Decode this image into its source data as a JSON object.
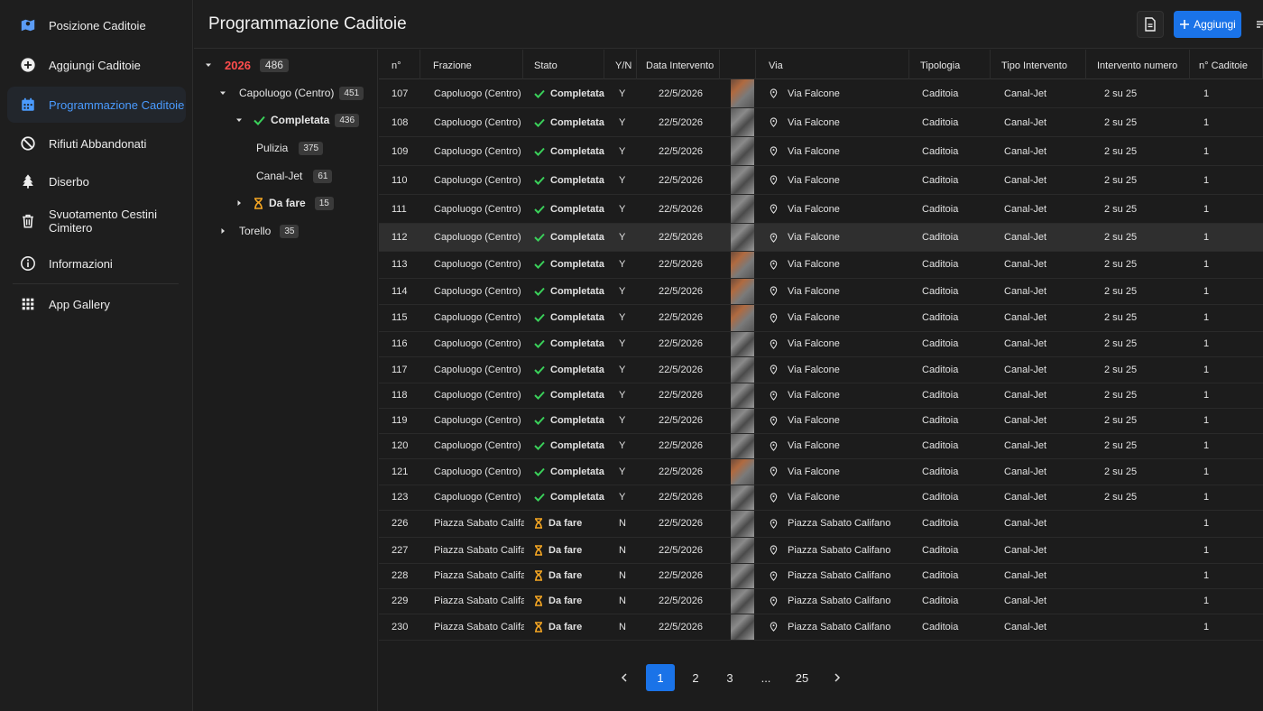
{
  "sidebar": {
    "items": [
      {
        "label": "Posizione Caditoie",
        "icon": "map-marker-icon"
      },
      {
        "label": "Aggiungi Caditoie",
        "icon": "add-circle-icon"
      },
      {
        "label": "Programmazione Caditoie",
        "icon": "calendar-icon"
      },
      {
        "label": "Rifiuti Abbandonati",
        "icon": "block-icon"
      },
      {
        "label": "Diserbo",
        "icon": "tree-icon"
      },
      {
        "label": "Svuotamento Cestini Cimitero",
        "icon": "trash-icon"
      },
      {
        "label": "Informazioni",
        "icon": "info-icon"
      },
      {
        "label": "App Gallery",
        "icon": "grid-icon"
      }
    ],
    "active_index": 2,
    "accent": "#4a9bff"
  },
  "header": {
    "title": "Programmazione Caditoie",
    "add_label": "Aggiungi"
  },
  "tree": {
    "year": {
      "label": "2026",
      "count": "486"
    },
    "capoluogo": {
      "label": "Capoluogo (Centro)",
      "count": "451"
    },
    "completata": {
      "label": "Completata",
      "count": "436"
    },
    "pulizia": {
      "label": "Pulizia",
      "count": "375"
    },
    "canaljet": {
      "label": "Canal-Jet",
      "count": "61"
    },
    "dafare": {
      "label": "Da fare",
      "count": "15"
    },
    "torello": {
      "label": "Torello",
      "count": "35"
    }
  },
  "table": {
    "columns": [
      "n°",
      "Frazione",
      "Stato",
      "Y/N",
      "Data Intervento",
      "",
      "Via",
      "Tipologia",
      "Tipo Intervento",
      "Intervento numero",
      "n° Caditoie"
    ],
    "rows": [
      {
        "n": "107",
        "frazione": "Capoluogo (Centro)",
        "stato": "Completata",
        "yn": "Y",
        "data": "22/5/2026",
        "via": "Via Falcone",
        "tipologia": "Caditoia",
        "tipo": "Canal-Jet",
        "num": "2 su 25",
        "cad": "1"
      },
      {
        "n": "108",
        "frazione": "Capoluogo (Centro)",
        "stato": "Completata",
        "yn": "Y",
        "data": "22/5/2026",
        "via": "Via Falcone",
        "tipologia": "Caditoia",
        "tipo": "Canal-Jet",
        "num": "2 su 25",
        "cad": "1"
      },
      {
        "n": "109",
        "frazione": "Capoluogo (Centro)",
        "stato": "Completata",
        "yn": "Y",
        "data": "22/5/2026",
        "via": "Via Falcone",
        "tipologia": "Caditoia",
        "tipo": "Canal-Jet",
        "num": "2 su 25",
        "cad": "1"
      },
      {
        "n": "110",
        "frazione": "Capoluogo (Centro)",
        "stato": "Completata",
        "yn": "Y",
        "data": "22/5/2026",
        "via": "Via Falcone",
        "tipologia": "Caditoia",
        "tipo": "Canal-Jet",
        "num": "2 su 25",
        "cad": "1"
      },
      {
        "n": "111",
        "frazione": "Capoluogo (Centro)",
        "stato": "Completata",
        "yn": "Y",
        "data": "22/5/2026",
        "via": "Via Falcone",
        "tipologia": "Caditoia",
        "tipo": "Canal-Jet",
        "num": "2 su 25",
        "cad": "1"
      },
      {
        "n": "112",
        "frazione": "Capoluogo (Centro)",
        "stato": "Completata",
        "yn": "Y",
        "data": "22/5/2026",
        "via": "Via Falcone",
        "tipologia": "Caditoia",
        "tipo": "Canal-Jet",
        "num": "2 su 25",
        "cad": "1"
      },
      {
        "n": "113",
        "frazione": "Capoluogo (Centro)",
        "stato": "Completata",
        "yn": "Y",
        "data": "22/5/2026",
        "via": "Via Falcone",
        "tipologia": "Caditoia",
        "tipo": "Canal-Jet",
        "num": "2 su 25",
        "cad": "1"
      },
      {
        "n": "114",
        "frazione": "Capoluogo (Centro)",
        "stato": "Completata",
        "yn": "Y",
        "data": "22/5/2026",
        "via": "Via Falcone",
        "tipologia": "Caditoia",
        "tipo": "Canal-Jet",
        "num": "2 su 25",
        "cad": "1"
      },
      {
        "n": "115",
        "frazione": "Capoluogo (Centro)",
        "stato": "Completata",
        "yn": "Y",
        "data": "22/5/2026",
        "via": "Via Falcone",
        "tipologia": "Caditoia",
        "tipo": "Canal-Jet",
        "num": "2 su 25",
        "cad": "1"
      },
      {
        "n": "116",
        "frazione": "Capoluogo (Centro)",
        "stato": "Completata",
        "yn": "Y",
        "data": "22/5/2026",
        "via": "Via Falcone",
        "tipologia": "Caditoia",
        "tipo": "Canal-Jet",
        "num": "2 su 25",
        "cad": "1"
      },
      {
        "n": "117",
        "frazione": "Capoluogo (Centro)",
        "stato": "Completata",
        "yn": "Y",
        "data": "22/5/2026",
        "via": "Via Falcone",
        "tipologia": "Caditoia",
        "tipo": "Canal-Jet",
        "num": "2 su 25",
        "cad": "1"
      },
      {
        "n": "118",
        "frazione": "Capoluogo (Centro)",
        "stato": "Completata",
        "yn": "Y",
        "data": "22/5/2026",
        "via": "Via Falcone",
        "tipologia": "Caditoia",
        "tipo": "Canal-Jet",
        "num": "2 su 25",
        "cad": "1"
      },
      {
        "n": "119",
        "frazione": "Capoluogo (Centro)",
        "stato": "Completata",
        "yn": "Y",
        "data": "22/5/2026",
        "via": "Via Falcone",
        "tipologia": "Caditoia",
        "tipo": "Canal-Jet",
        "num": "2 su 25",
        "cad": "1"
      },
      {
        "n": "120",
        "frazione": "Capoluogo (Centro)",
        "stato": "Completata",
        "yn": "Y",
        "data": "22/5/2026",
        "via": "Via Falcone",
        "tipologia": "Caditoia",
        "tipo": "Canal-Jet",
        "num": "2 su 25",
        "cad": "1"
      },
      {
        "n": "121",
        "frazione": "Capoluogo (Centro)",
        "stato": "Completata",
        "yn": "Y",
        "data": "22/5/2026",
        "via": "Via Falcone",
        "tipologia": "Caditoia",
        "tipo": "Canal-Jet",
        "num": "2 su 25",
        "cad": "1"
      },
      {
        "n": "123",
        "frazione": "Capoluogo (Centro)",
        "stato": "Completata",
        "yn": "Y",
        "data": "22/5/2026",
        "via": "Via Falcone",
        "tipologia": "Caditoia",
        "tipo": "Canal-Jet",
        "num": "2 su 25",
        "cad": "1"
      },
      {
        "n": "226",
        "frazione": "Piazza Sabato Califano",
        "stato": "Da fare",
        "yn": "N",
        "data": "22/5/2026",
        "via": "Piazza Sabato Califano",
        "tipologia": "Caditoia",
        "tipo": "Canal-Jet",
        "num": "",
        "cad": "1"
      },
      {
        "n": "227",
        "frazione": "Piazza Sabato Califano",
        "stato": "Da fare",
        "yn": "N",
        "data": "22/5/2026",
        "via": "Piazza Sabato Califano",
        "tipologia": "Caditoia",
        "tipo": "Canal-Jet",
        "num": "",
        "cad": "1"
      },
      {
        "n": "228",
        "frazione": "Piazza Sabato Califano",
        "stato": "Da fare",
        "yn": "N",
        "data": "22/5/2026",
        "via": "Piazza Sabato Califano",
        "tipologia": "Caditoia",
        "tipo": "Canal-Jet",
        "num": "",
        "cad": "1"
      },
      {
        "n": "229",
        "frazione": "Piazza Sabato Califano",
        "stato": "Da fare",
        "yn": "N",
        "data": "22/5/2026",
        "via": "Piazza Sabato Califano",
        "tipologia": "Caditoia",
        "tipo": "Canal-Jet",
        "num": "",
        "cad": "1"
      },
      {
        "n": "230",
        "frazione": "Piazza Sabato Califano",
        "stato": "Da fare",
        "yn": "N",
        "data": "22/5/2026",
        "via": "Piazza Sabato Califano",
        "tipologia": "Caditoia",
        "tipo": "Canal-Jet",
        "num": "",
        "cad": "1"
      }
    ],
    "selected_row_index": 5
  },
  "status_colors": {
    "Completata": "#3ad15a",
    "Da fare": "#f5a623"
  },
  "pagination": {
    "pages": [
      "1",
      "2",
      "3",
      "...",
      "25"
    ],
    "current": "1"
  }
}
